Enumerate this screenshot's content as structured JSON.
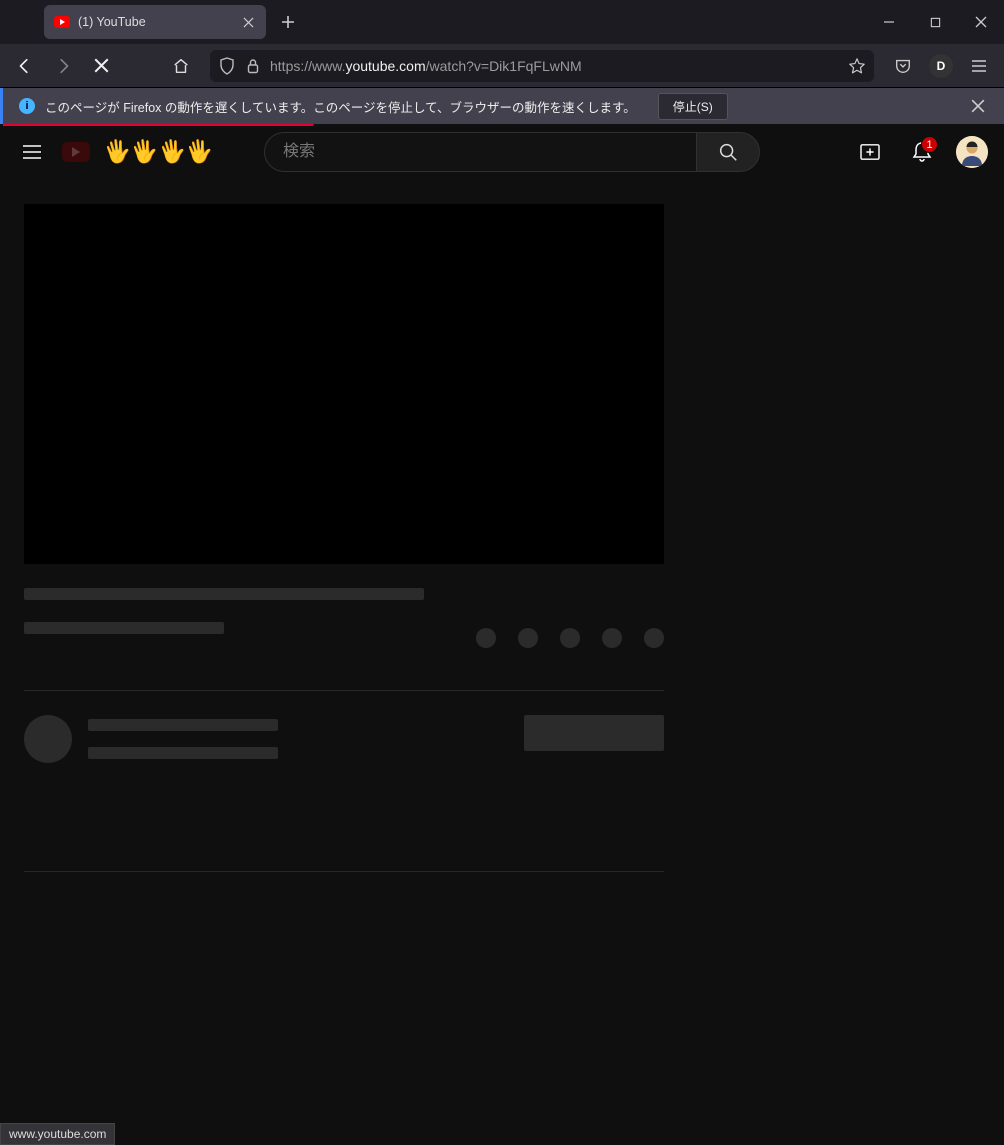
{
  "window": {
    "tab_title": "(1) YouTube"
  },
  "toolbar": {
    "url_prefix": "https://www.",
    "url_host": "youtube.com",
    "url_path": "/watch?v=Dik1FqFLwNM",
    "extension_badge": "D"
  },
  "notification": {
    "message": "このページが Firefox の動作を遅くしています。このページを停止して、ブラウザーの動作を速くします。",
    "stop_label": "停止(S)"
  },
  "youtube": {
    "search_placeholder": "検索",
    "notif_count": "1"
  },
  "status": {
    "text": "www.youtube.com"
  }
}
